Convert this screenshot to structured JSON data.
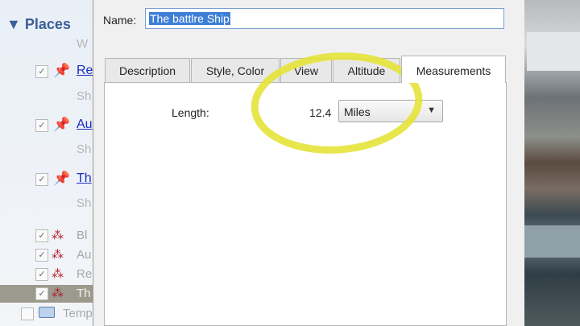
{
  "places": {
    "header": "▼ Places",
    "rows": [
      {
        "label": "Re",
        "sub": "Sh"
      },
      {
        "label": "Au",
        "sub": "Sh"
      },
      {
        "label": "Th",
        "sub": "Sh"
      }
    ],
    "top_sub": "W",
    "gray_rows": [
      "Bl",
      "Au",
      "Re",
      "Th"
    ],
    "temp_label": "Temp"
  },
  "dialog": {
    "name_label": "Name:",
    "name_value": "The battlre Ship",
    "tabs": [
      "Description",
      "Style, Color",
      "View",
      "Altitude",
      "Measurements"
    ],
    "active_tab": "Measurements",
    "length_label": "Length:",
    "length_value": "12.4",
    "unit_selected": "Miles"
  },
  "colors": {
    "highlight": "#e6e33a",
    "selection": "#3e7fd6",
    "link": "#1a2cc2"
  }
}
